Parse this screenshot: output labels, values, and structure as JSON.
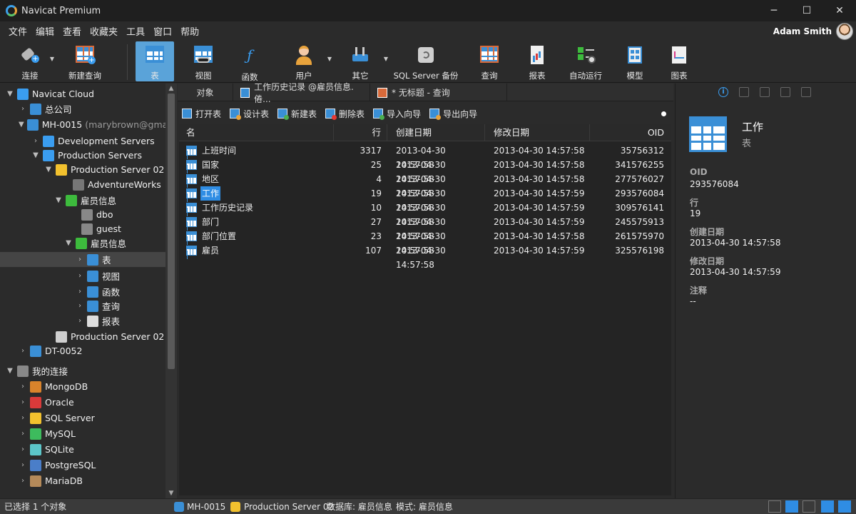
{
  "window": {
    "title": "Navicat Premium",
    "minimize": "─",
    "maximize": "☐",
    "close": "✕"
  },
  "menu": [
    "文件",
    "编辑",
    "查看",
    "收藏夹",
    "工具",
    "窗口",
    "帮助"
  ],
  "user": {
    "name": "Adam Smith"
  },
  "toolbar": [
    {
      "label": "连接",
      "icon": "plug-icon",
      "has_caret": true
    },
    {
      "label": "新建查询",
      "icon": "new-query-icon",
      "has_caret": false
    },
    {
      "label": "表",
      "icon": "table-icon",
      "active": true
    },
    {
      "label": "视图",
      "icon": "view-icon"
    },
    {
      "label": "函数",
      "icon": "function-icon"
    },
    {
      "label": "用户",
      "icon": "user-icon",
      "has_caret": true
    },
    {
      "label": "其它",
      "icon": "tools-icon",
      "has_caret": true
    },
    {
      "label": "SQL Server 备份",
      "icon": "backup-icon"
    },
    {
      "label": "查询",
      "icon": "query-icon"
    },
    {
      "label": "报表",
      "icon": "report-icon"
    },
    {
      "label": "自动运行",
      "icon": "automation-icon"
    },
    {
      "label": "模型",
      "icon": "model-icon"
    },
    {
      "label": "图表",
      "icon": "chart-icon"
    }
  ],
  "tree": [
    {
      "label": "Navicat Cloud",
      "icon": "cloud-icon",
      "twisty": "▼",
      "color": "#3a9df0"
    },
    {
      "label": "总公司",
      "icon": "gear-cloud-icon",
      "twisty": "›",
      "color": "#3a8fd6"
    },
    {
      "label": "MH-0015",
      "muted": " (marybrown@gmai",
      "icon": "project-icon",
      "twisty": "▼",
      "color": "#3a8fd6"
    },
    {
      "label": "Development Servers",
      "icon": "server-group-icon",
      "twisty": "›",
      "color": "#3a9df0"
    },
    {
      "label": "Production Servers",
      "icon": "server-group-icon",
      "twisty": "▼",
      "color": "#3a9df0"
    },
    {
      "label": "Production Server 02",
      "icon": "sqlserver-icon",
      "twisty": "▼",
      "color": "#f2c12e"
    },
    {
      "label": "AdventureWorks",
      "icon": "database-icon",
      "twisty": "",
      "color": "#777777"
    },
    {
      "label": "雇员信息",
      "icon": "database-icon",
      "twisty": "▼",
      "color": "#3dbb3d"
    },
    {
      "label": "dbo",
      "icon": "schema-icon",
      "twisty": "",
      "color": "#888888"
    },
    {
      "label": "guest",
      "icon": "schema-icon",
      "twisty": "",
      "color": "#888888"
    },
    {
      "label": "雇员信息",
      "icon": "schema-icon",
      "twisty": "▼",
      "color": "#3dbb3d"
    },
    {
      "label": "表",
      "icon": "table-icon",
      "twisty": "›",
      "color": "#3a8fd6",
      "selected": true
    },
    {
      "label": "视图",
      "icon": "view-icon",
      "twisty": "›",
      "color": "#3a8fd6"
    },
    {
      "label": "函数",
      "icon": "function-icon",
      "twisty": "›",
      "color": "#3a8fd6"
    },
    {
      "label": "查询",
      "icon": "query-icon",
      "twisty": "›",
      "color": "#3a8fd6"
    },
    {
      "label": "报表",
      "icon": "report-icon",
      "twisty": "›",
      "color": "#dddddd"
    },
    {
      "label": "Production Server 02",
      "icon": "sqlserver-icon",
      "twisty": "",
      "color": "#cfcfcf"
    },
    {
      "label": "DT-0052",
      "icon": "project-icon",
      "twisty": "›",
      "color": "#3a8fd6"
    },
    {
      "label": "我的连接",
      "icon": "connections-icon",
      "twisty": "▼",
      "color": "#888888"
    },
    {
      "label": "MongoDB",
      "icon": "mongodb-icon",
      "twisty": "›",
      "color": "#d9832b"
    },
    {
      "label": "Oracle",
      "icon": "oracle-icon",
      "twisty": "›",
      "color": "#d93a3a"
    },
    {
      "label": "SQL Server",
      "icon": "sqlserver-icon",
      "twisty": "›",
      "color": "#f2c12e"
    },
    {
      "label": "MySQL",
      "icon": "mysql-icon",
      "twisty": "›",
      "color": "#3dbb5d"
    },
    {
      "label": "SQLite",
      "icon": "sqlite-icon",
      "twisty": "›",
      "color": "#5cc6c9"
    },
    {
      "label": "PostgreSQL",
      "icon": "postgresql-icon",
      "twisty": "›",
      "color": "#4a7ec9"
    },
    {
      "label": "MariaDB",
      "icon": "mariadb-icon",
      "twisty": "›",
      "color": "#b58a5a"
    }
  ],
  "tabs": [
    {
      "label": "对象"
    },
    {
      "label": "工作历史记录 @雇员信息.倦..."
    },
    {
      "label": "* 无标题 - 查询"
    }
  ],
  "object_toolbar": [
    {
      "label": "打开表",
      "icon": "open-table-icon",
      "badge": ""
    },
    {
      "label": "设计表",
      "icon": "design-table-icon",
      "badge": "#e8a33c"
    },
    {
      "label": "新建表",
      "icon": "new-table-icon",
      "badge": "#4caf50"
    },
    {
      "label": "删除表",
      "icon": "delete-table-icon",
      "badge": "#e53935"
    },
    {
      "label": "导入向导",
      "icon": "import-icon",
      "badge": "#4caf50"
    },
    {
      "label": "导出向导",
      "icon": "export-icon",
      "badge": "#e8a33c"
    }
  ],
  "table": {
    "headers": {
      "name": "名",
      "rows": "行",
      "created": "创建日期",
      "modified": "修改日期",
      "oid": "OID"
    },
    "rows": [
      {
        "name": "上班时间",
        "rows": "3317",
        "created": "2013-04-30 14:57:58",
        "modified": "2013-04-30 14:57:58",
        "oid": "35756312"
      },
      {
        "name": "国家",
        "rows": "25",
        "created": "2013-04-30 14:57:58",
        "modified": "2013-04-30 14:57:58",
        "oid": "341576255"
      },
      {
        "name": "地区",
        "rows": "4",
        "created": "2013-04-30 14:57:58",
        "modified": "2013-04-30 14:57:58",
        "oid": "277576027"
      },
      {
        "name": "工作",
        "rows": "19",
        "created": "2013-04-30 14:57:58",
        "modified": "2013-04-30 14:57:59",
        "oid": "293576084",
        "selected": true
      },
      {
        "name": "工作历史记录",
        "rows": "10",
        "created": "2013-04-30 14:57:58",
        "modified": "2013-04-30 14:57:59",
        "oid": "309576141"
      },
      {
        "name": "部门",
        "rows": "27",
        "created": "2013-04-30 14:57:58",
        "modified": "2013-04-30 14:57:59",
        "oid": "245575913"
      },
      {
        "name": "部门位置",
        "rows": "23",
        "created": "2013-04-30 14:57:58",
        "modified": "2013-04-30 14:57:58",
        "oid": "261575970"
      },
      {
        "name": "雇员",
        "rows": "107",
        "created": "2013-04-30 14:57:58",
        "modified": "2013-04-30 14:57:59",
        "oid": "325576198"
      }
    ]
  },
  "info": {
    "tab_info_glyph": "i",
    "title": "工作",
    "subtitle": "表",
    "fields": [
      {
        "key": "OID",
        "value": "293576084"
      },
      {
        "key": "行",
        "value": "19"
      },
      {
        "key": "创建日期",
        "value": "2013-04-30 14:57:58"
      },
      {
        "key": "修改日期",
        "value": "2013-04-30 14:57:59"
      },
      {
        "key": "注释",
        "value": "--"
      }
    ]
  },
  "status": {
    "selection": "已选择 1 个对象",
    "project": "MH-0015",
    "server": "Production Server 02",
    "database": "数据库: 雇员信息",
    "schema": "模式: 雇员信息"
  }
}
